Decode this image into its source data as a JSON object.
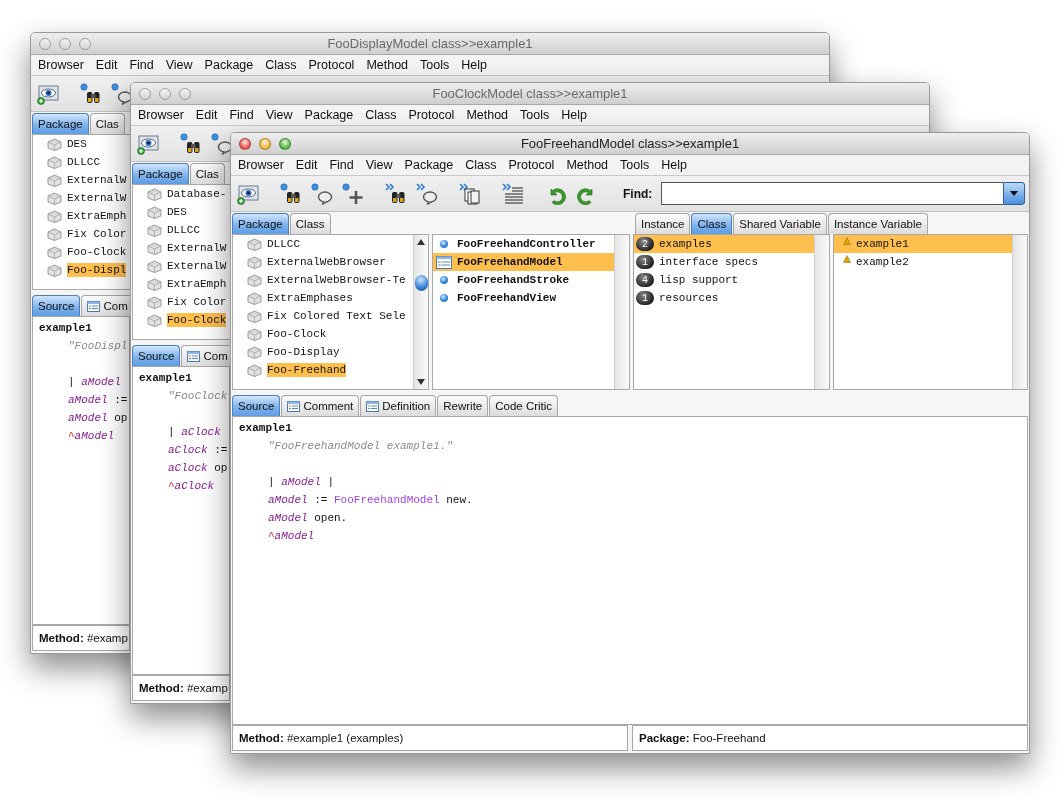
{
  "windows": [
    {
      "title": "FooDisplayModel class>>example1",
      "active": false,
      "menu": [
        "Browser",
        "Edit",
        "Find",
        "View",
        "Package",
        "Class",
        "Protocol",
        "Method",
        "Tools",
        "Help"
      ],
      "tools": [
        {
          "kind": "eye"
        },
        {
          "kind": "binoculars"
        },
        {
          "kind": "bubble"
        }
      ],
      "package_tabs": [
        {
          "label": "Package",
          "selected": true
        },
        {
          "label": "Clas",
          "selected": false
        }
      ],
      "packages": [
        {
          "name": "DES",
          "selected": false
        },
        {
          "name": "DLLCC",
          "selected": false
        },
        {
          "name": "ExternalW",
          "selected": false
        },
        {
          "name": "ExternalW",
          "selected": false
        },
        {
          "name": "ExtraEmph",
          "selected": false
        },
        {
          "name": "Fix Color",
          "selected": false
        },
        {
          "name": "Foo-Clock",
          "selected": false
        },
        {
          "name": "Foo-Displ",
          "selected": true
        }
      ],
      "source_tabs": [
        {
          "label": "Source",
          "kind": "plain",
          "selected": true
        },
        {
          "label": "Com",
          "kind": "doc",
          "selected": false
        }
      ],
      "code": [
        {
          "kind": "header",
          "segments": [
            {
              "kind": "bold",
              "text": "example1"
            }
          ]
        },
        {
          "kind": "body",
          "segments": [
            {
              "kind": "comment",
              "text": "\"FooDispl"
            }
          ]
        },
        {
          "kind": "blank"
        },
        {
          "kind": "body",
          "segments": [
            {
              "kind": "plain",
              "text": "| "
            },
            {
              "kind": "temp",
              "text": "aModel"
            }
          ]
        },
        {
          "kind": "body",
          "segments": [
            {
              "kind": "temp",
              "text": "aModel"
            },
            {
              "kind": "plain",
              "text": " :="
            }
          ]
        },
        {
          "kind": "body",
          "segments": [
            {
              "kind": "temp",
              "text": "aModel"
            },
            {
              "kind": "plain",
              "text": " op"
            }
          ]
        },
        {
          "kind": "body",
          "segments": [
            {
              "kind": "return",
              "text": "^"
            },
            {
              "kind": "temp",
              "text": "aModel"
            }
          ]
        }
      ],
      "status": [
        "**Method:** #examp"
      ]
    },
    {
      "title": "FooClockModel class>>example1",
      "active": false,
      "menu": [
        "Browser",
        "Edit",
        "Find",
        "View",
        "Package",
        "Class",
        "Protocol",
        "Method",
        "Tools",
        "Help"
      ],
      "tools": [
        {
          "kind": "eye"
        },
        {
          "kind": "binoculars"
        },
        {
          "kind": "bubble"
        }
      ],
      "package_tabs": [
        {
          "label": "Package",
          "selected": true
        },
        {
          "label": "Clas",
          "selected": false
        }
      ],
      "packages": [
        {
          "name": "Database-",
          "selected": false
        },
        {
          "name": "DES",
          "selected": false
        },
        {
          "name": "DLLCC",
          "selected": false
        },
        {
          "name": "ExternalW",
          "selected": false
        },
        {
          "name": "ExternalW",
          "selected": false
        },
        {
          "name": "ExtraEmph",
          "selected": false
        },
        {
          "name": "Fix Color",
          "selected": false
        },
        {
          "name": "Foo-Clock",
          "selected": true
        }
      ],
      "source_tabs": [
        {
          "label": "Source",
          "kind": "plain",
          "selected": true
        },
        {
          "label": "Com",
          "kind": "doc",
          "selected": false
        }
      ],
      "code": [
        {
          "kind": "header",
          "segments": [
            {
              "kind": "bold",
              "text": "example1"
            }
          ]
        },
        {
          "kind": "body",
          "segments": [
            {
              "kind": "comment",
              "text": "\"FooClock"
            }
          ]
        },
        {
          "kind": "blank"
        },
        {
          "kind": "body",
          "segments": [
            {
              "kind": "plain",
              "text": "| "
            },
            {
              "kind": "temp",
              "text": "aClock"
            }
          ]
        },
        {
          "kind": "body",
          "segments": [
            {
              "kind": "temp",
              "text": "aClock"
            },
            {
              "kind": "plain",
              "text": " :="
            }
          ]
        },
        {
          "kind": "body",
          "segments": [
            {
              "kind": "temp",
              "text": "aClock"
            },
            {
              "kind": "plain",
              "text": " op"
            }
          ]
        },
        {
          "kind": "body",
          "segments": [
            {
              "kind": "return",
              "text": "^"
            },
            {
              "kind": "temp",
              "text": "aClock"
            }
          ]
        }
      ],
      "status": [
        "**Method:** #examp"
      ]
    },
    {
      "title": "FooFreehandModel class>>example1",
      "active": true,
      "menu": [
        "Browser",
        "Edit",
        "Find",
        "View",
        "Package",
        "Class",
        "Protocol",
        "Method",
        "Tools",
        "Help"
      ],
      "tools": [
        {
          "kind": "eye"
        },
        {
          "kind": "binoculars"
        },
        {
          "kind": "bubble"
        },
        {
          "kind": "plus"
        },
        {
          "kind": "binoculars-next"
        },
        {
          "kind": "bubble-next"
        },
        {
          "kind": "pages-next"
        },
        {
          "kind": "lines-next"
        },
        {
          "kind": "undo"
        },
        {
          "kind": "redo"
        }
      ],
      "find": {
        "label": "Find:"
      },
      "package_tabs": [
        {
          "label": "Package",
          "selected": true
        },
        {
          "label": "Class",
          "selected": false
        }
      ],
      "class_tabs": [
        {
          "label": "Instance",
          "selected": false
        },
        {
          "label": "Class",
          "selected": true
        },
        {
          "label": "Shared Variable",
          "selected": false
        },
        {
          "label": "Instance Variable",
          "selected": false
        }
      ],
      "packages": [
        {
          "name": "DLLCC",
          "selected": false
        },
        {
          "name": "ExternalWebBrowser",
          "selected": false
        },
        {
          "name": "ExternalWebBrowser-Te",
          "selected": false
        },
        {
          "name": "ExtraEmphases",
          "selected": false
        },
        {
          "name": "Fix Colored Text Sele",
          "selected": false
        },
        {
          "name": "Foo-Clock",
          "selected": false
        },
        {
          "name": "Foo-Display",
          "selected": false
        },
        {
          "name": "Foo-Freehand",
          "selected": true
        }
      ],
      "classes": [
        {
          "name": "FooFreehandController",
          "kind": "dot",
          "selected": false
        },
        {
          "name": "FooFreehandModel",
          "kind": "form",
          "selected": true
        },
        {
          "name": "FooFreehandStroke",
          "kind": "dot",
          "selected": false
        },
        {
          "name": "FooFreehandView",
          "kind": "dot",
          "selected": false
        }
      ],
      "protocols": [
        {
          "count": "2",
          "name": "examples",
          "selected": true
        },
        {
          "count": "1",
          "name": "interface specs",
          "selected": false
        },
        {
          "count": "4",
          "name": "lisp support",
          "selected": false
        },
        {
          "count": "1",
          "name": "resources",
          "selected": false
        }
      ],
      "methods": [
        {
          "name": "example1",
          "selected": true
        },
        {
          "name": "example2",
          "selected": false
        }
      ],
      "source_tabs": [
        {
          "label": "Source",
          "kind": "plain",
          "selected": true
        },
        {
          "label": "Comment",
          "kind": "doc",
          "selected": false
        },
        {
          "label": "Definition",
          "kind": "doc",
          "selected": false
        },
        {
          "label": "Rewrite",
          "kind": "plain",
          "selected": false
        },
        {
          "label": "Code Critic",
          "kind": "plain",
          "selected": false
        }
      ],
      "code": [
        {
          "kind": "header",
          "segments": [
            {
              "kind": "bold",
              "text": "example1"
            }
          ]
        },
        {
          "kind": "body",
          "segments": [
            {
              "kind": "comment",
              "text": "\"FooFreehandModel example1.\""
            }
          ]
        },
        {
          "kind": "blank"
        },
        {
          "kind": "body",
          "segments": [
            {
              "kind": "plain",
              "text": "| "
            },
            {
              "kind": "temp",
              "text": "aModel"
            },
            {
              "kind": "plain",
              "text": " |"
            }
          ]
        },
        {
          "kind": "body",
          "segments": [
            {
              "kind": "temp",
              "text": "aModel"
            },
            {
              "kind": "plain",
              "text": " := "
            },
            {
              "kind": "class",
              "text": "FooFreehandModel"
            },
            {
              "kind": "plain",
              "text": " new."
            }
          ]
        },
        {
          "kind": "body",
          "segments": [
            {
              "kind": "temp",
              "text": "aModel"
            },
            {
              "kind": "plain",
              "text": " open."
            }
          ]
        },
        {
          "kind": "body",
          "segments": [
            {
              "kind": "return",
              "text": "^"
            },
            {
              "kind": "temp",
              "text": "aModel"
            }
          ]
        }
      ],
      "status": [
        "**Method:** #example1 (examples)",
        "**Package:** Foo-Freehand"
      ]
    }
  ]
}
